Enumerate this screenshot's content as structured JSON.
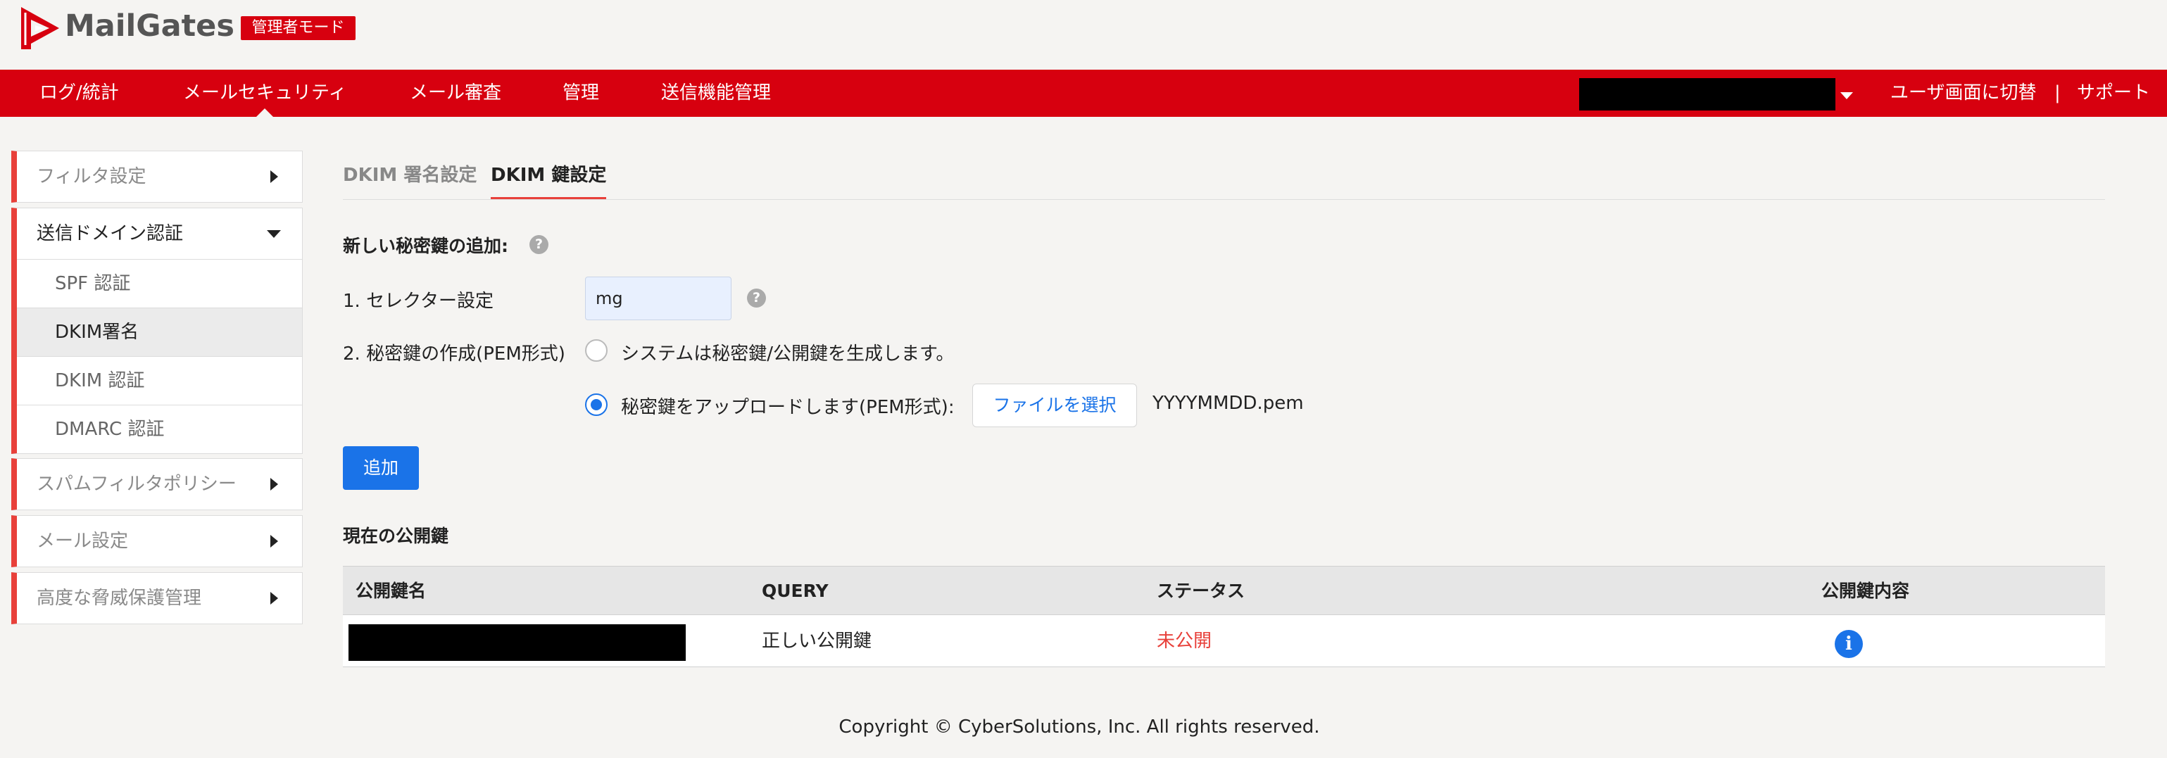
{
  "header": {
    "logo_text": "MailGates",
    "admin_badge": "管理者モード"
  },
  "nav": {
    "items": [
      "ログ/統計",
      "メールセキュリティ",
      "メール審査",
      "管理",
      "送信機能管理"
    ],
    "active_index": 1,
    "switch_user": "ユーザ画面に切替",
    "separator": "|",
    "support": "サポート"
  },
  "sidebar": {
    "groups": [
      {
        "label": "フィルタ設定",
        "expanded": false
      },
      {
        "label": "送信ドメイン認証",
        "expanded": true,
        "children": [
          "SPF 認証",
          "DKIM署名",
          "DKIM 認証",
          "DMARC 認証"
        ],
        "active_child": 1
      },
      {
        "label": "スパムフィルタポリシー",
        "expanded": false
      },
      {
        "label": "メール設定",
        "expanded": false
      },
      {
        "label": "高度な脅威保護管理",
        "expanded": false
      }
    ]
  },
  "tabs": {
    "items": [
      "DKIM 署名設定",
      "DKIM 鍵設定"
    ],
    "active_index": 1
  },
  "add_key": {
    "title": "新しい秘密鍵の追加:",
    "help_icon": "?",
    "selector_label": "1. セレクター設定",
    "selector_value": "mg",
    "create_label": "2. 秘密鍵の作成(PEM形式)",
    "option_generate": "システムは秘密鍵/公開鍵を生成します。",
    "option_upload": "秘密鍵をアップロードします(PEM形式):",
    "selected_option": "upload",
    "file_button": "ファイルを選択",
    "file_name": "YYYYMMDD.pem",
    "add_button": "追加"
  },
  "public_keys": {
    "title": "現在の公開鍵",
    "columns": [
      "公開鍵名",
      "QUERY",
      "ステータス",
      "公開鍵内容"
    ],
    "rows": [
      {
        "name": "",
        "query": "正しい公開鍵",
        "status": "未公開",
        "detail_icon": "info-icon"
      }
    ]
  },
  "colors": {
    "brand_red": "#d7000f",
    "accent_red": "#e8403a",
    "primary_blue": "#1a73e8"
  },
  "footer": {
    "copyright": "Copyright © CyberSolutions, Inc. All rights reserved."
  }
}
